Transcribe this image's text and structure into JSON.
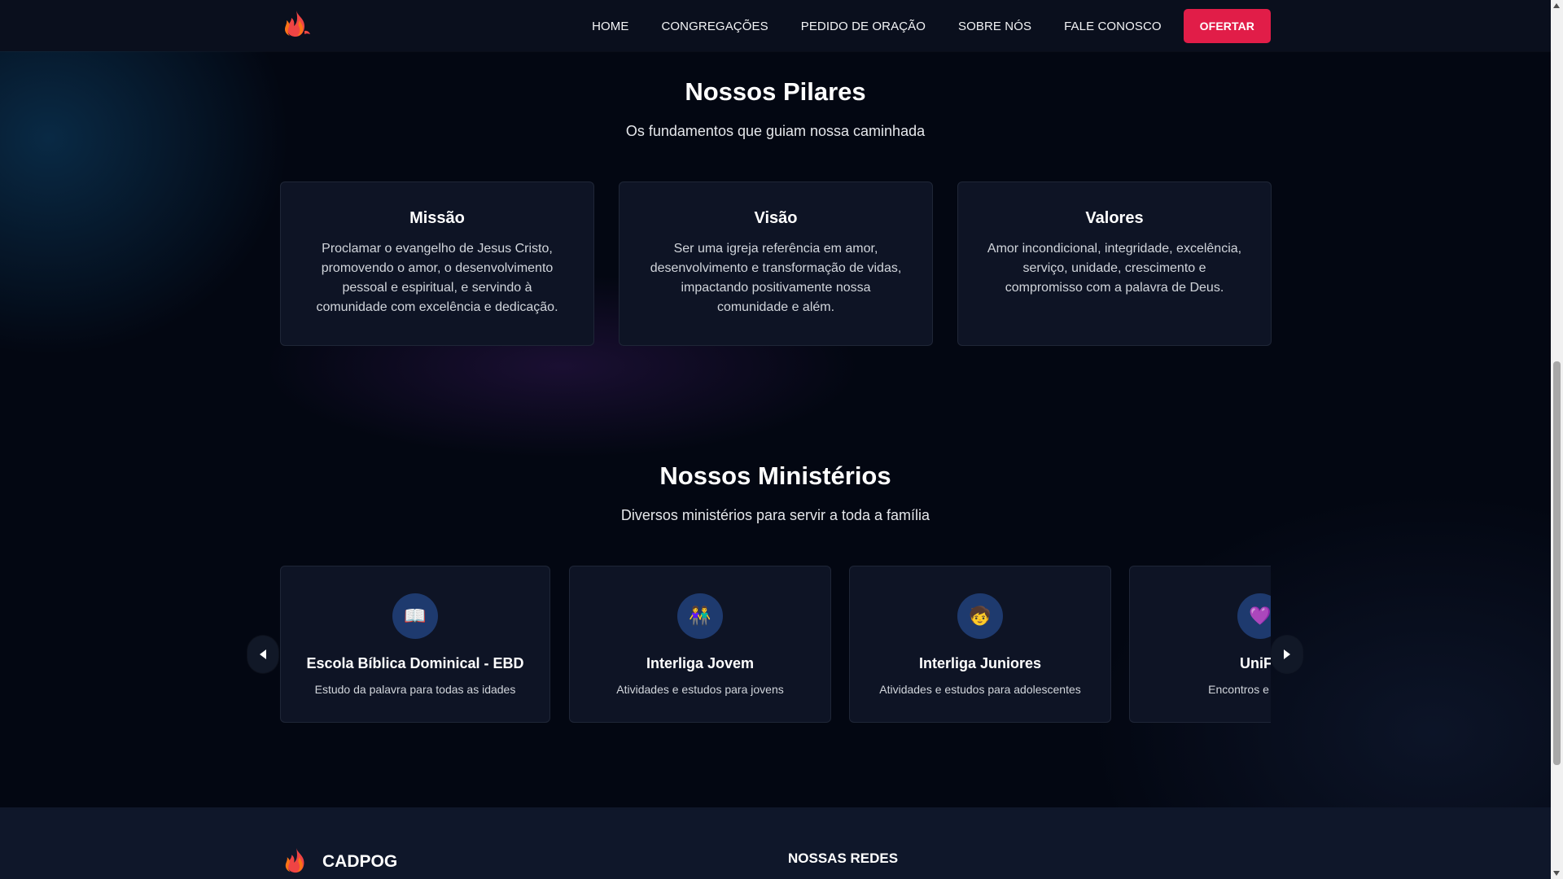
{
  "nav": {
    "items": [
      "HOME",
      "CONGREGAÇÕES",
      "PEDIDO DE ORAÇÃO",
      "SOBRE NÓS",
      "FALE CONOSCO"
    ],
    "cta": "OFERTAR",
    "cta_color": "#e11d48",
    "logo_icon": "flame-icon"
  },
  "pillars": {
    "title": "Nossos Pilares",
    "subtitle": "Os fundamentos que guiam nossa caminhada",
    "cards": [
      {
        "title": "Missão",
        "text": "Proclamar o evangelho de Jesus Cristo, promovendo o amor, o desenvolvimento pessoal e espiritual, e servindo à comunidade com excelência e dedicação."
      },
      {
        "title": "Visão",
        "text": "Ser uma igreja referência em amor, desenvolvimento e transformação de vidas, impactando positivamente nossa comunidade e além."
      },
      {
        "title": "Valores",
        "text": "Amor incondicional, integridade, excelência, serviço, unidade, crescimento e compromisso com a palavra de Deus."
      }
    ]
  },
  "ministries": {
    "title": "Nossos Ministérios",
    "subtitle": "Diversos ministérios para servir a toda a família",
    "cards": [
      {
        "icon": "📖",
        "icon_name": "open-book-icon",
        "title": "Escola Bíblica Dominical - EBD",
        "text": "Estudo da palavra para todas as idades"
      },
      {
        "icon": "👫",
        "icon_name": "couple-icon",
        "title": "Interliga Jovem",
        "text": "Atividades e estudos para jovens"
      },
      {
        "icon": "🧒",
        "icon_name": "child-icon",
        "title": "Interliga Juniores",
        "text": "Atividades e estudos para adolescentes"
      },
      {
        "icon": "💜",
        "icon_name": "purple-heart-icon",
        "title": "UniFe",
        "text": "Encontros e estudos"
      }
    ],
    "prev_icon": "triangle-left-icon",
    "next_icon": "triangle-right-icon"
  },
  "footer": {
    "brand": "CADPOG",
    "social_heading": "NOSSAS REDES"
  }
}
